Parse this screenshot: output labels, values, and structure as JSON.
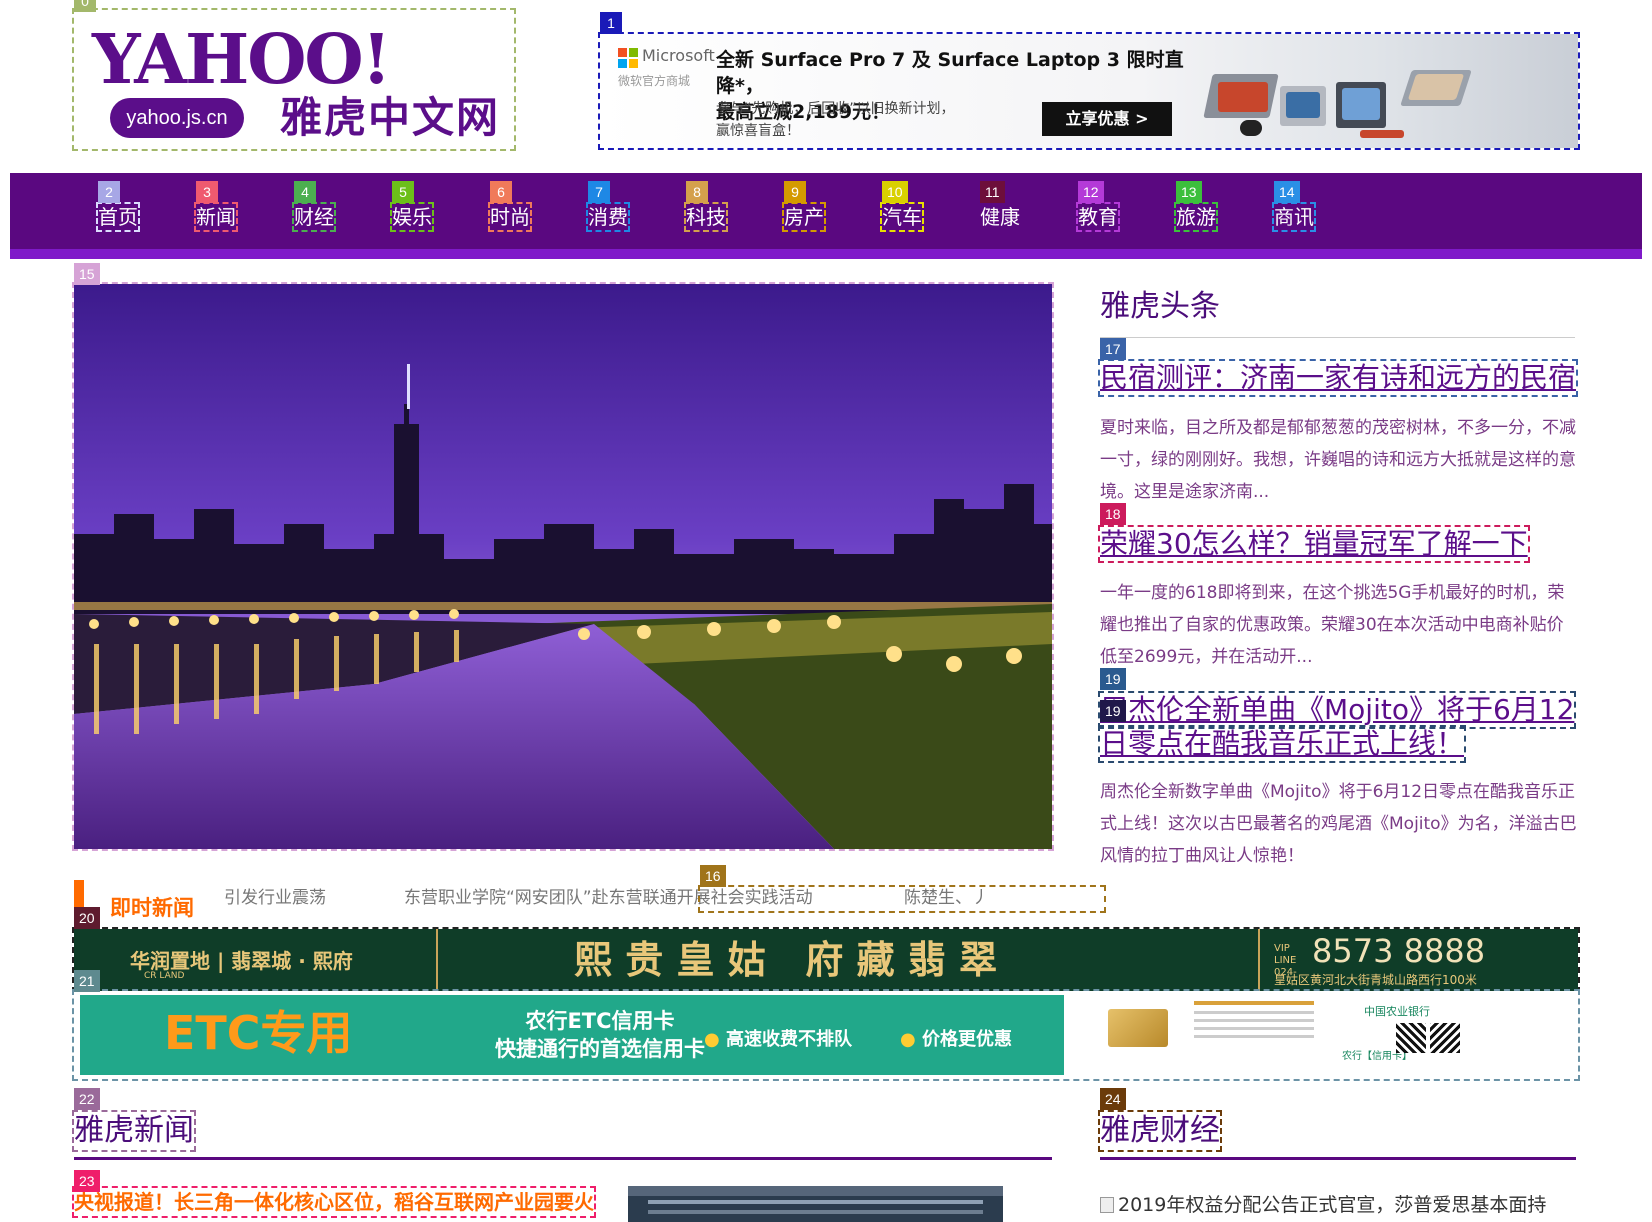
{
  "badges": {
    "b0": "0",
    "b1": "1",
    "b2": "2",
    "b3": "3",
    "b4": "4",
    "b5": "5",
    "b6": "6",
    "b7": "7",
    "b8": "8",
    "b9": "9",
    "b10": "10",
    "b11": "11",
    "b12": "12",
    "b13": "13",
    "b14": "14",
    "b15": "15",
    "b16": "16",
    "b17": "17",
    "b18": "18",
    "b19": "19",
    "b20": "20",
    "b21": "21",
    "b22": "22",
    "b23": "23",
    "b24": "24"
  },
  "logo": {
    "wordmark": "YAHOO!",
    "domain": "yahoo.js.cn",
    "cn_name": "雅虎中文网"
  },
  "top_ad": {
    "brand": "Microsoft",
    "store": "微软官方商城",
    "headline_line1": "全新 Surface Pro 7 及 Surface Laptop 3 限时直降*，",
    "headline_line2": "最高立减2,189元！",
    "sub_line1": "参与“先购机，后回收”以旧换新计划，",
    "sub_line2": "赢惊喜盲盒！",
    "cta": "立享优惠 >"
  },
  "nav": {
    "items": [
      "首页",
      "新闻",
      "财经",
      "娱乐",
      "时尚",
      "消费",
      "科技",
      "房产",
      "汽车",
      "健康",
      "教育",
      "旅游",
      "商讯"
    ]
  },
  "headlines": {
    "title": "雅虎头条",
    "items": [
      {
        "title": "民宿测评：济南一家有诗和远方的民宿",
        "summary": "夏时来临，目之所及都是郁郁葱葱的茂密树林，不多一分，不减一寸，绿的刚刚好。我想，许巍唱的诗和远方大抵就是这样的意境。这里是途家济南..."
      },
      {
        "title": "荣耀30怎么样？销量冠军了解一下",
        "summary": "一年一度的618即将到来，在这个挑选5G手机最好的时机，荣耀也推出了自家的优惠政策。荣耀30在本次活动中电商补贴价低至2699元，并在活动开..."
      },
      {
        "title_line1": "周杰伦全新单曲《Mojito》将于6月12",
        "title_line2": "日零点在酷我音乐正式上线！",
        "summary": "周杰伦全新数字单曲《Mojito》将于6月12日零点在酷我音乐正式上线！这次以古巴最著名的鸡尾酒《Mojito》为名，洋溢古巴风情的拉丁曲风让人惊艳！"
      }
    ]
  },
  "ticker": {
    "label": "即时新闻",
    "items": [
      "引发行业震荡",
      "东营职业学院“网安团队”赴东营联通开展社会实践活动",
      "陈楚生、丿"
    ]
  },
  "jade_ad": {
    "brand": "华润置地 | 翡翠城 · 熙府",
    "brand_en": "CR LAND",
    "slogan": "熙 贵 皇 姑   府 藏 翡 翠",
    "vip": "VIP LINE 024-",
    "phone": "8573 8888",
    "address": "皇姑区黄河北大街青城山路西行100米"
  },
  "etc_ad": {
    "big": "ETC专用",
    "line1": "农行ETC信用卡",
    "line2": "快捷通行的首选信用卡",
    "feature1": "高速收费不排队",
    "feature2": "价格更优惠",
    "bank": "中国农业银行",
    "card_label": "农行【信用卡】"
  },
  "sections": {
    "news_title": "雅虎新闻",
    "finance_title": "雅虎财经",
    "lead_news": "央视报道！长三角一体化核心区位，稻谷互联网产业园要火",
    "finance_item": "2019年权益分配公告正式官宣，莎普爱思基本面持"
  },
  "colors": {
    "brand_purple": "#5a0880",
    "accent_orange": "#ff6a00",
    "headline_purple": "#5b0e8a",
    "summary_text": "#7a3b86"
  }
}
